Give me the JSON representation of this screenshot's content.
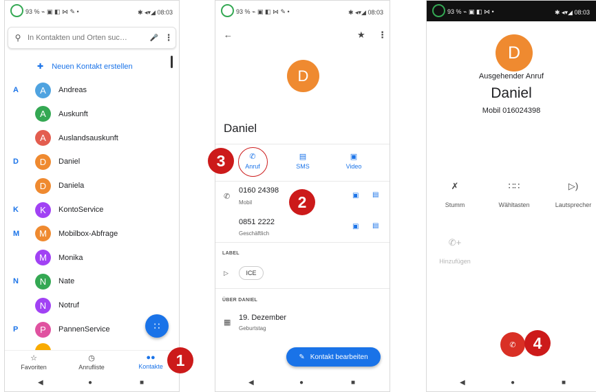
{
  "status_bar": {
    "left": "93 % ⌁ ▣ ◧ ⋈ ✎ •",
    "right": "✱ ◂▾◢ 08:03",
    "right_p2": "✱ ◂▾◢ 08:03",
    "left_p3": "93 % ⌁ ▣ ◧ ⋈ •",
    "right_p3": "✱ ◂▾◢ 08:03"
  },
  "contacts_screen": {
    "search_placeholder": "In Kontakten und Orten suc…",
    "new_contact_label": "Neuen Kontakt erstellen",
    "contacts": [
      {
        "letter": "A",
        "initial": "A",
        "name": "Andreas",
        "color": "#4fa3e0"
      },
      {
        "letter": "",
        "initial": "A",
        "name": "Auskunft",
        "color": "#34a853"
      },
      {
        "letter": "",
        "initial": "A",
        "name": "Auslandsauskunft",
        "color": "#e35d4f"
      },
      {
        "letter": "D",
        "initial": "D",
        "name": "Daniel",
        "color": "#ef8a30"
      },
      {
        "letter": "",
        "initial": "D",
        "name": "Daniela",
        "color": "#ef8a30"
      },
      {
        "letter": "K",
        "initial": "K",
        "name": "KontoService",
        "color": "#a142f4"
      },
      {
        "letter": "M",
        "initial": "M",
        "name": "Mobilbox-Abfrage",
        "color": "#ef8a30"
      },
      {
        "letter": "",
        "initial": "M",
        "name": "Monika",
        "color": "#a142f4"
      },
      {
        "letter": "N",
        "initial": "N",
        "name": "Nate",
        "color": "#34a853"
      },
      {
        "letter": "",
        "initial": "N",
        "name": "Notruf",
        "color": "#a142f4"
      },
      {
        "letter": "P",
        "initial": "P",
        "name": "PannenService",
        "color": "#e052a0"
      }
    ],
    "nav": {
      "favorites": "Favoriten",
      "call_log": "Anrufliste",
      "contacts": "Kontakte"
    }
  },
  "contact_detail": {
    "initial": "D",
    "name": "Daniel",
    "actions": {
      "call": "Anruf",
      "sms": "SMS",
      "video": "Video"
    },
    "numbers": [
      {
        "number": "0160 24398",
        "type": "Mobil"
      },
      {
        "number": "0851 2222",
        "type": "Geschäftlich"
      }
    ],
    "label_heading": "LABEL",
    "label_chip": "ICE",
    "about_heading": "ÜBER DANIEL",
    "birthday": "19. Dezember",
    "birthday_type": "Geburtstag",
    "edit_button": "Kontakt bearbeiten"
  },
  "call_screen": {
    "initial": "D",
    "status": "Ausgehender Anruf",
    "name": "Daniel",
    "number": "Mobil 016024398",
    "controls": {
      "mute": "Stumm",
      "keypad": "Wähltasten",
      "speaker": "Lautsprecher",
      "add_call": "Hinzufügen"
    }
  },
  "badges": {
    "b1": "1",
    "b2": "2",
    "b3": "3",
    "b4": "4"
  },
  "nav_glyphs": {
    "back": "◀",
    "home": "●",
    "recents": "■"
  },
  "colors": {
    "accent": "#1a73e8",
    "badge": "#cc1a1a",
    "hangup": "#d93025",
    "avatar_daniel": "#ef8a30"
  }
}
